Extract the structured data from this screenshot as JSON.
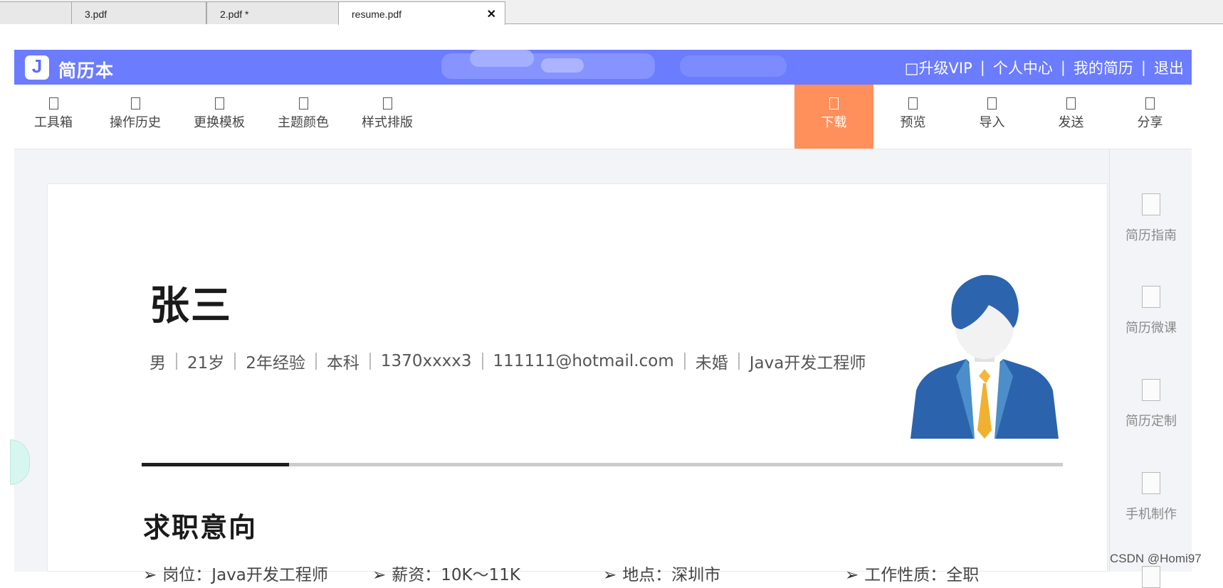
{
  "tabs": [
    {
      "label": "3.pdf"
    },
    {
      "label": "2.pdf *"
    },
    {
      "label": "resume.pdf",
      "close": "✕"
    }
  ],
  "header": {
    "logo_letter": "J",
    "logo_text": "简历本",
    "links": [
      "□升级VIP",
      "个人中心",
      "我的简历",
      "退出"
    ],
    "separator": "|",
    "background": "#6b7cff"
  },
  "toolbar": {
    "left": [
      {
        "label": "工具箱",
        "icon": "toolbox-icon"
      },
      {
        "label": "操作历史",
        "icon": "history-icon"
      },
      {
        "label": "更换模板",
        "icon": "template-icon"
      },
      {
        "label": "主题颜色",
        "icon": "theme-color-icon"
      },
      {
        "label": "样式排版",
        "icon": "layout-icon"
      }
    ],
    "right": [
      {
        "label": "下载",
        "icon": "download-icon"
      },
      {
        "label": "预览",
        "icon": "preview-icon"
      },
      {
        "label": "导入",
        "icon": "import-icon"
      },
      {
        "label": "发送",
        "icon": "send-icon"
      },
      {
        "label": "分享",
        "icon": "share-icon"
      }
    ],
    "highlight_color": "#ff8f5b"
  },
  "side_panel": {
    "items": [
      "简历指南",
      "简历微课",
      "简历定制",
      "手机制作"
    ]
  },
  "resume": {
    "name": "张三",
    "info": [
      "男",
      "21岁",
      "2年经验",
      "本科",
      "1370xxxx3",
      "111111@hotmail.com",
      "未婚",
      "Java开发工程师"
    ],
    "section_title": "求职意向",
    "intent": [
      {
        "arrow": "➢",
        "text": "岗位：Java开发工程师"
      },
      {
        "arrow": "➢",
        "text": "薪资：10K～11K"
      },
      {
        "arrow": "➢",
        "text": "地点：深圳市"
      },
      {
        "arrow": "➢",
        "text": "工作性质：全职"
      }
    ]
  },
  "watermark": "CSDN @Homi97"
}
